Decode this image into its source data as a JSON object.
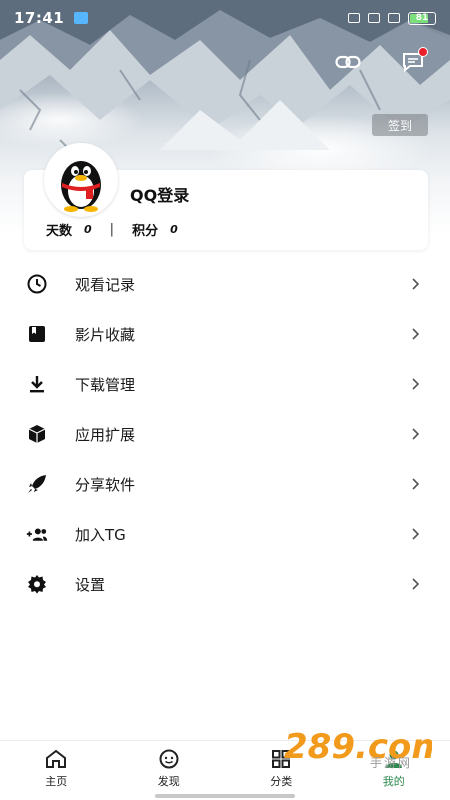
{
  "status_bar": {
    "time": "17:41",
    "battery": "81"
  },
  "header": {
    "signin_label": "签到"
  },
  "profile": {
    "login_label": "QQ登录",
    "days_label": "天数",
    "days_value": "0",
    "points_label": "积分",
    "points_value": "0"
  },
  "menu": {
    "items": [
      {
        "label": "观看记录",
        "icon": "clock-icon"
      },
      {
        "label": "影片收藏",
        "icon": "bookmark-icon"
      },
      {
        "label": "下载管理",
        "icon": "download-icon"
      },
      {
        "label": "应用扩展",
        "icon": "cube-icon"
      },
      {
        "label": "分享软件",
        "icon": "rocket-icon"
      },
      {
        "label": "加入TG",
        "icon": "add-group-icon"
      },
      {
        "label": "设置",
        "icon": "gear-icon"
      }
    ]
  },
  "bottom_nav": {
    "items": [
      {
        "label": "主页",
        "icon": "home-icon"
      },
      {
        "label": "发现",
        "icon": "discover-icon"
      },
      {
        "label": "分类",
        "icon": "grid-icon"
      },
      {
        "label": "我的",
        "icon": "profile-icon",
        "active": true
      }
    ]
  },
  "watermark": {
    "logo": "289.com",
    "text": "手游网"
  },
  "colors": {
    "accent_active": "#2d8a4e",
    "notification_dot": "#e8202a"
  }
}
